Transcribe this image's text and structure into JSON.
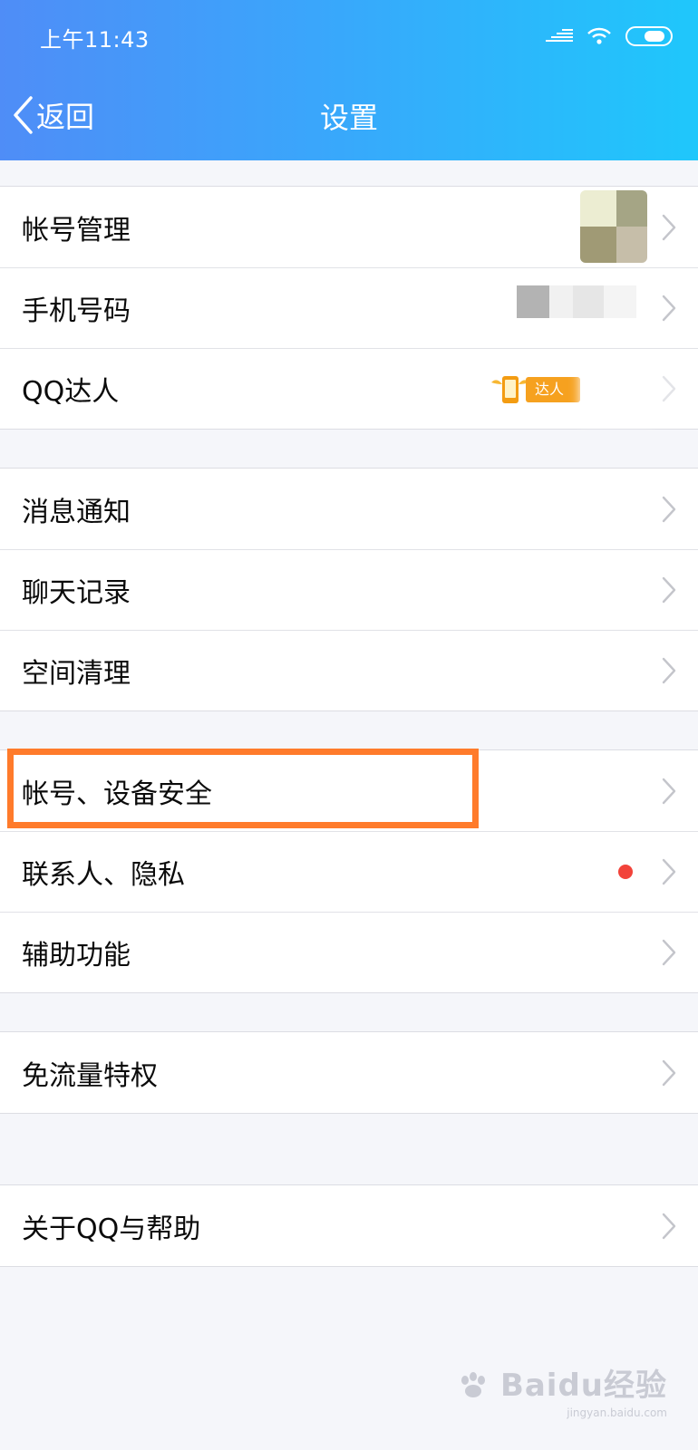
{
  "status_bar": {
    "time": "上午11:43",
    "icons": [
      "signal-icon",
      "wifi-icon",
      "battery-icon"
    ]
  },
  "nav": {
    "back_label": "返回",
    "title": "设置"
  },
  "groups": [
    {
      "items": [
        {
          "label": "帐号管理",
          "accessory": "avatar-thumbnail (blurred)"
        },
        {
          "label": "手机号码",
          "accessory": "masked phone number"
        },
        {
          "label": "QQ达人",
          "accessory": "daren-badge",
          "badge_text": "达人"
        }
      ]
    },
    {
      "items": [
        {
          "label": "消息通知"
        },
        {
          "label": "聊天记录"
        },
        {
          "label": "空间清理"
        }
      ]
    },
    {
      "items": [
        {
          "label": "帐号、设备安全",
          "highlighted": true
        },
        {
          "label": "联系人、隐私",
          "accessory": "red-dot"
        },
        {
          "label": "辅助功能"
        }
      ]
    },
    {
      "items": [
        {
          "label": "免流量特权"
        }
      ]
    },
    {
      "items": [
        {
          "label": "关于QQ与帮助"
        }
      ]
    }
  ],
  "colors": {
    "header_gradient_start": "#4f8df7",
    "header_gradient_end": "#1fc7fb",
    "highlight_border": "#ff7b2b",
    "notification_dot": "#f2433a",
    "background": "#f5f6fa"
  },
  "watermark": {
    "main": "Baidu经验",
    "sub": "jingyan.baidu.com"
  }
}
